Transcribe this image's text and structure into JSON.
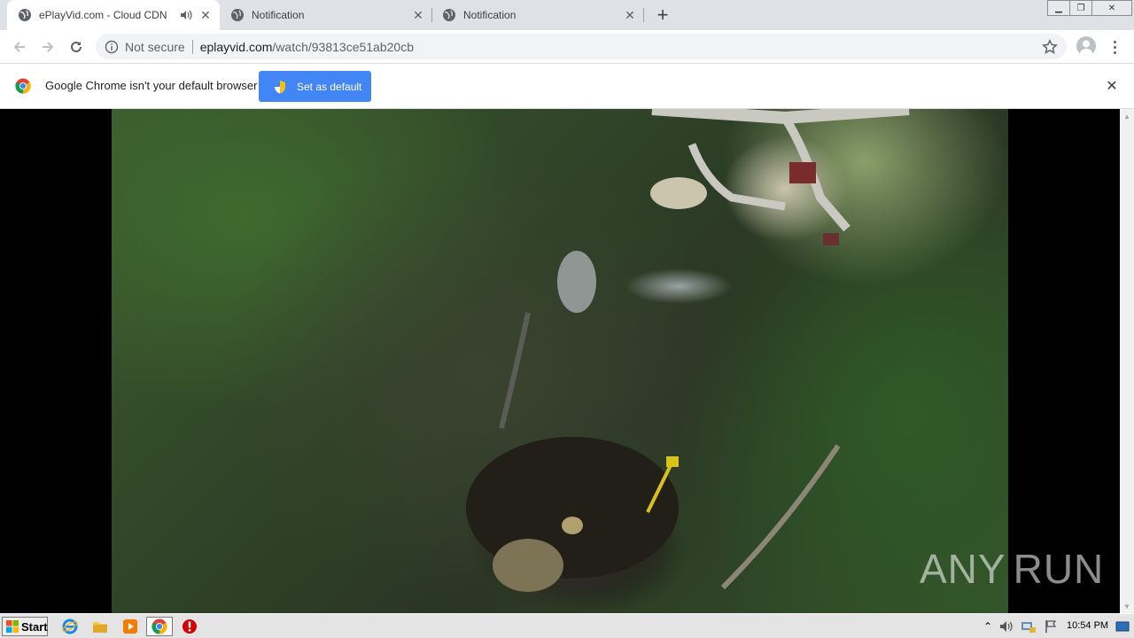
{
  "tabs": [
    {
      "title": "ePlayVid.com - Cloud CDN",
      "active": true,
      "audio": true
    },
    {
      "title": "Notification",
      "active": false
    },
    {
      "title": "Notification",
      "active": false
    }
  ],
  "omnibox": {
    "security_label": "Not secure",
    "host": "eplayvid.com",
    "path": "/watch/93813ce51ab20cb"
  },
  "infobar": {
    "message": "Google Chrome isn't your default browser",
    "button_label": "Set as default"
  },
  "watermark": {
    "left": "ANY",
    "right": "RUN"
  },
  "taskbar": {
    "start_label": "Start",
    "clock": "10:54 PM"
  },
  "colors": {
    "accent": "#4285f4",
    "tabstrip": "#dee1e6"
  }
}
